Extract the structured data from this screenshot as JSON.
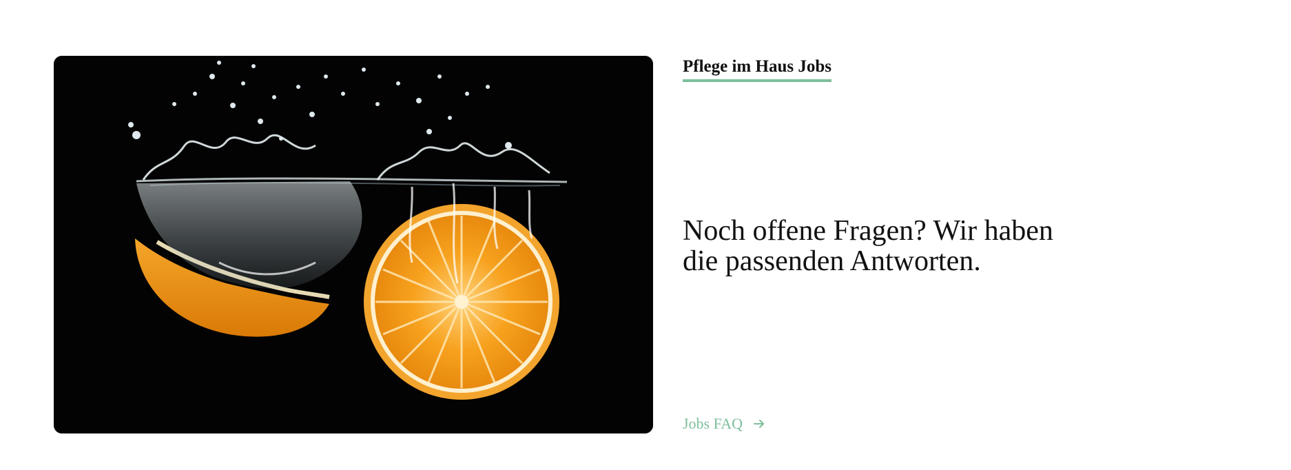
{
  "section": {
    "eyebrow": "Pflege im Haus Jobs",
    "headline_line1": "Noch offene Fragen? Wir haben",
    "headline_line2": "die passenden Antworten.",
    "link_label": "Jobs FAQ",
    "link_icon": "arrow-right-icon"
  },
  "image": {
    "alt": "Orange halves splashing into water",
    "background_color": "#030303",
    "fruit_color": "#f0a020"
  },
  "colors": {
    "accent": "#7dbf9c",
    "text": "#111111",
    "background": "#ffffff"
  }
}
